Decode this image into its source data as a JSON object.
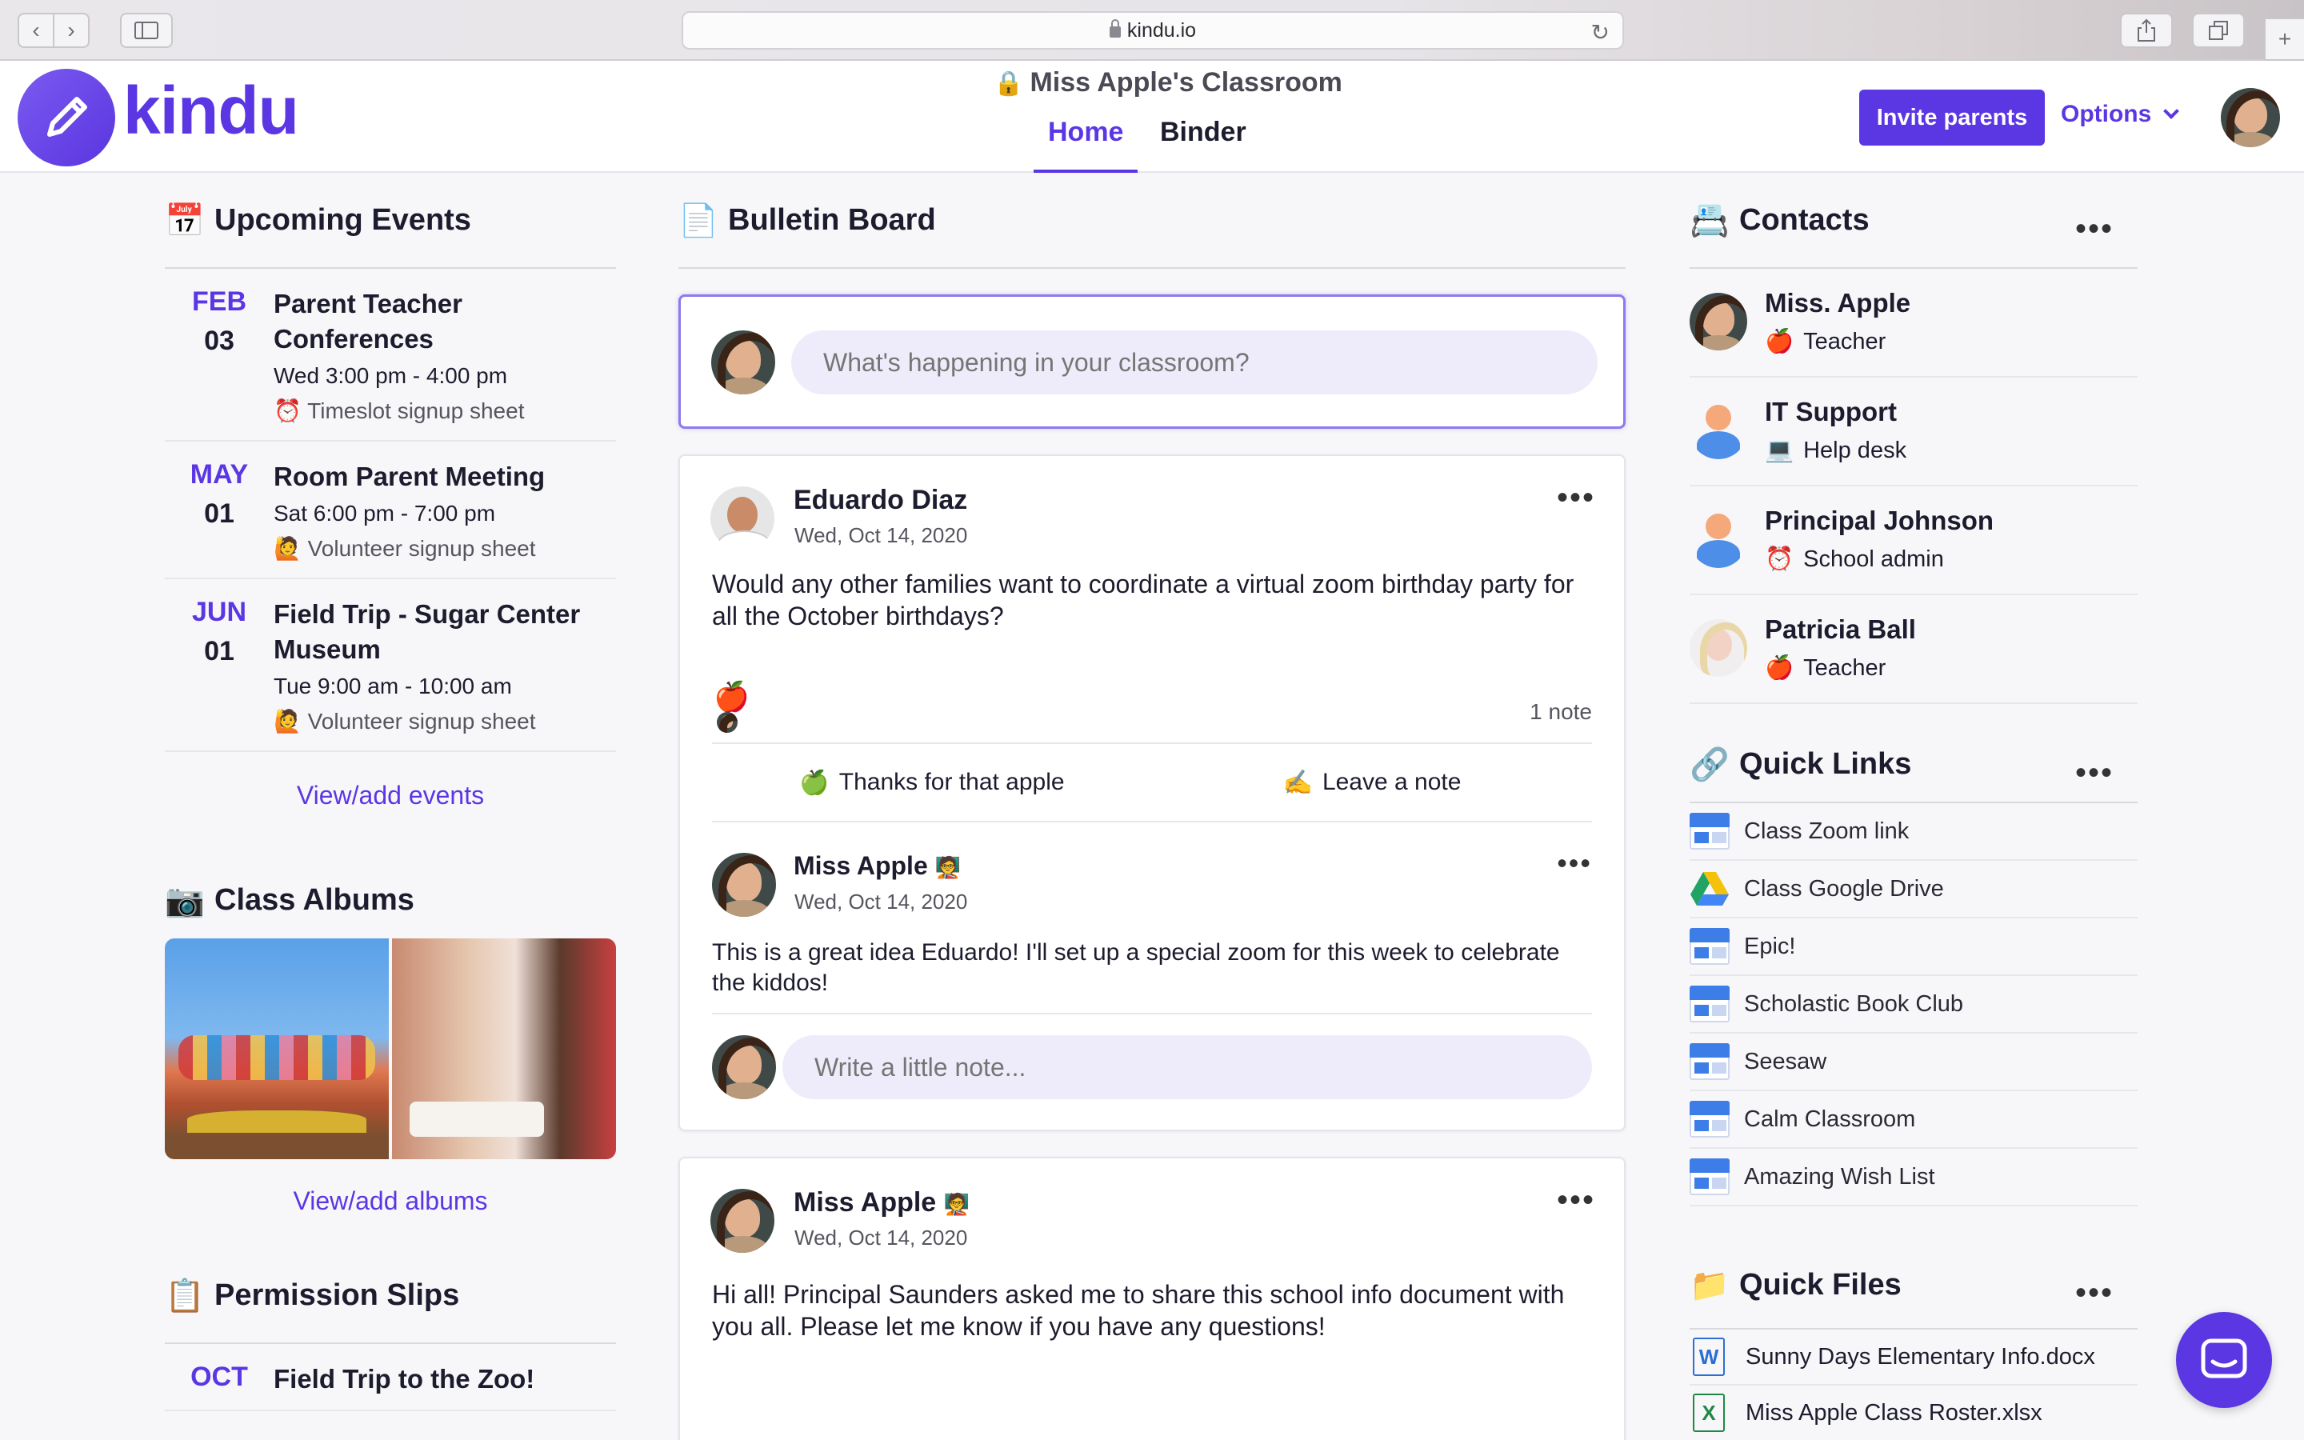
{
  "browser": {
    "url": "kindu.io"
  },
  "header": {
    "logo_text": "kindu",
    "classroom_title": "Miss Apple's Classroom",
    "tabs": [
      {
        "label": "Home",
        "active": true
      },
      {
        "label": "Binder",
        "active": false
      }
    ],
    "invite_label": "Invite parents",
    "options_label": "Options",
    "accent_color": "#5b36e3"
  },
  "events": {
    "title": "Upcoming Events",
    "items": [
      {
        "month": "FEB",
        "day": "03",
        "name": "Parent Teacher Conferences",
        "time": "Wed 3:00 pm - 4:00 pm",
        "sheet": "Timeslot signup sheet",
        "sheet_icon": "⏰"
      },
      {
        "month": "MAY",
        "day": "01",
        "name": "Room Parent Meeting",
        "time": "Sat 6:00 pm - 7:00 pm",
        "sheet": "Volunteer signup sheet",
        "sheet_icon": "🙋"
      },
      {
        "month": "JUN",
        "day": "01",
        "name": "Field Trip - Sugar Center Museum",
        "time": "Tue 9:00 am - 10:00 am",
        "sheet": "Volunteer signup sheet",
        "sheet_icon": "🙋"
      }
    ],
    "view_link": "View/add events"
  },
  "albums": {
    "title": "Class Albums",
    "view_link": "View/add albums"
  },
  "permission": {
    "title": "Permission Slips",
    "items": [
      {
        "month": "OCT",
        "name": "Field Trip to the Zoo!"
      }
    ]
  },
  "bulletin": {
    "title": "Bulletin Board",
    "composer_placeholder": "What's happening in your classroom?",
    "posts": [
      {
        "author": "Eduardo Diaz",
        "date": "Wed, Oct 14, 2020",
        "body": "Would any other families want to coordinate a virtual zoom birthday party for all the October birthdays?",
        "note_count": "1 note",
        "thanks_label": "Thanks for that apple",
        "note_label": "Leave a note",
        "reply": {
          "author": "Miss Apple",
          "badge": "🧑‍🏫",
          "date": "Wed, Oct 14, 2020",
          "body": "This is a great idea Eduardo! I'll set up a special zoom for this week to celebrate the kiddos!"
        },
        "note_placeholder": "Write a little note..."
      },
      {
        "author": "Miss Apple",
        "badge": "🧑‍🏫",
        "date": "Wed, Oct 14, 2020",
        "body": "Hi all! Principal Saunders asked me to share this school info document with you all. Please let me know if you have any questions!"
      }
    ]
  },
  "contacts": {
    "title": "Contacts",
    "items": [
      {
        "name": "Miss. Apple",
        "role": "Teacher",
        "role_icon": "🍎"
      },
      {
        "name": "IT Support",
        "role": "Help desk",
        "role_icon": "💻"
      },
      {
        "name": "Principal Johnson",
        "role": "School admin",
        "role_icon": "⏰"
      },
      {
        "name": "Patricia Ball",
        "role": "Teacher",
        "role_icon": "🍎"
      }
    ]
  },
  "quick_links": {
    "title": "Quick Links",
    "items": [
      {
        "label": "Class Zoom link",
        "icon": "doc"
      },
      {
        "label": "Class Google Drive",
        "icon": "drive"
      },
      {
        "label": "Epic!",
        "icon": "doc"
      },
      {
        "label": "Scholastic Book Club",
        "icon": "doc"
      },
      {
        "label": "Seesaw",
        "icon": "doc"
      },
      {
        "label": "Calm Classroom",
        "icon": "doc"
      },
      {
        "label": "Amazing Wish List",
        "icon": "doc"
      }
    ]
  },
  "quick_files": {
    "title": "Quick Files",
    "items": [
      {
        "label": "Sunny Days Elementary Info.docx",
        "type": "word"
      },
      {
        "label": "Miss Apple Class Roster.xlsx",
        "type": "excel"
      }
    ]
  }
}
